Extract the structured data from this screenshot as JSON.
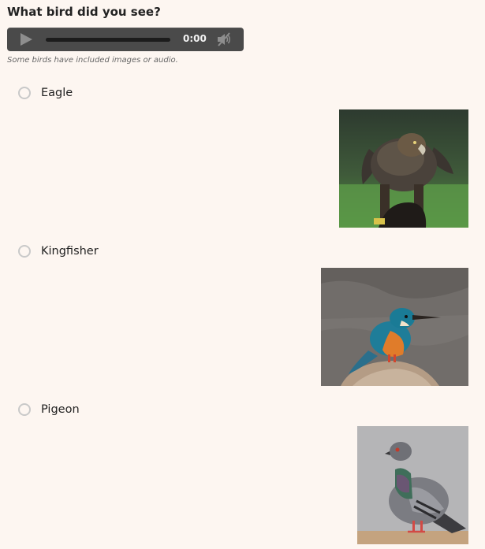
{
  "question": {
    "title": "What bird did you see?",
    "hint": "Some birds have included images or audio."
  },
  "audio_player": {
    "time": "0:00",
    "progress": 0,
    "play_icon": "play-icon",
    "mute_icon": "mute-icon",
    "colors": {
      "background": "#4a4a4a",
      "track": "#1c1c1c",
      "icon": "#8e8e8e"
    }
  },
  "options": [
    {
      "label": "Eagle",
      "selected": false,
      "image": "eagle-image"
    },
    {
      "label": "Kingfisher",
      "selected": false,
      "image": "kingfisher-image"
    },
    {
      "label": "Pigeon",
      "selected": false,
      "image": "pigeon-image"
    }
  ],
  "colors": {
    "page_background": "#fdf6f1",
    "radio_border": "#c9c9c9",
    "text": "#222222"
  }
}
